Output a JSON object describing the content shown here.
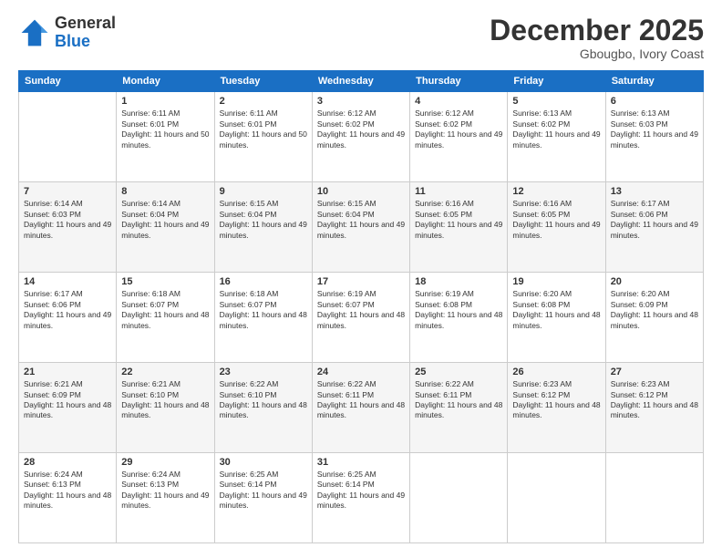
{
  "logo": {
    "general": "General",
    "blue": "Blue"
  },
  "header": {
    "month": "December 2025",
    "location": "Gbougbo, Ivory Coast"
  },
  "days_of_week": [
    "Sunday",
    "Monday",
    "Tuesday",
    "Wednesday",
    "Thursday",
    "Friday",
    "Saturday"
  ],
  "weeks": [
    [
      {
        "day": "",
        "sunrise": "",
        "sunset": "",
        "daylight": ""
      },
      {
        "day": "1",
        "sunrise": "Sunrise: 6:11 AM",
        "sunset": "Sunset: 6:01 PM",
        "daylight": "Daylight: 11 hours and 50 minutes."
      },
      {
        "day": "2",
        "sunrise": "Sunrise: 6:11 AM",
        "sunset": "Sunset: 6:01 PM",
        "daylight": "Daylight: 11 hours and 50 minutes."
      },
      {
        "day": "3",
        "sunrise": "Sunrise: 6:12 AM",
        "sunset": "Sunset: 6:02 PM",
        "daylight": "Daylight: 11 hours and 49 minutes."
      },
      {
        "day": "4",
        "sunrise": "Sunrise: 6:12 AM",
        "sunset": "Sunset: 6:02 PM",
        "daylight": "Daylight: 11 hours and 49 minutes."
      },
      {
        "day": "5",
        "sunrise": "Sunrise: 6:13 AM",
        "sunset": "Sunset: 6:02 PM",
        "daylight": "Daylight: 11 hours and 49 minutes."
      },
      {
        "day": "6",
        "sunrise": "Sunrise: 6:13 AM",
        "sunset": "Sunset: 6:03 PM",
        "daylight": "Daylight: 11 hours and 49 minutes."
      }
    ],
    [
      {
        "day": "7",
        "sunrise": "Sunrise: 6:14 AM",
        "sunset": "Sunset: 6:03 PM",
        "daylight": "Daylight: 11 hours and 49 minutes."
      },
      {
        "day": "8",
        "sunrise": "Sunrise: 6:14 AM",
        "sunset": "Sunset: 6:04 PM",
        "daylight": "Daylight: 11 hours and 49 minutes."
      },
      {
        "day": "9",
        "sunrise": "Sunrise: 6:15 AM",
        "sunset": "Sunset: 6:04 PM",
        "daylight": "Daylight: 11 hours and 49 minutes."
      },
      {
        "day": "10",
        "sunrise": "Sunrise: 6:15 AM",
        "sunset": "Sunset: 6:04 PM",
        "daylight": "Daylight: 11 hours and 49 minutes."
      },
      {
        "day": "11",
        "sunrise": "Sunrise: 6:16 AM",
        "sunset": "Sunset: 6:05 PM",
        "daylight": "Daylight: 11 hours and 49 minutes."
      },
      {
        "day": "12",
        "sunrise": "Sunrise: 6:16 AM",
        "sunset": "Sunset: 6:05 PM",
        "daylight": "Daylight: 11 hours and 49 minutes."
      },
      {
        "day": "13",
        "sunrise": "Sunrise: 6:17 AM",
        "sunset": "Sunset: 6:06 PM",
        "daylight": "Daylight: 11 hours and 49 minutes."
      }
    ],
    [
      {
        "day": "14",
        "sunrise": "Sunrise: 6:17 AM",
        "sunset": "Sunset: 6:06 PM",
        "daylight": "Daylight: 11 hours and 49 minutes."
      },
      {
        "day": "15",
        "sunrise": "Sunrise: 6:18 AM",
        "sunset": "Sunset: 6:07 PM",
        "daylight": "Daylight: 11 hours and 48 minutes."
      },
      {
        "day": "16",
        "sunrise": "Sunrise: 6:18 AM",
        "sunset": "Sunset: 6:07 PM",
        "daylight": "Daylight: 11 hours and 48 minutes."
      },
      {
        "day": "17",
        "sunrise": "Sunrise: 6:19 AM",
        "sunset": "Sunset: 6:07 PM",
        "daylight": "Daylight: 11 hours and 48 minutes."
      },
      {
        "day": "18",
        "sunrise": "Sunrise: 6:19 AM",
        "sunset": "Sunset: 6:08 PM",
        "daylight": "Daylight: 11 hours and 48 minutes."
      },
      {
        "day": "19",
        "sunrise": "Sunrise: 6:20 AM",
        "sunset": "Sunset: 6:08 PM",
        "daylight": "Daylight: 11 hours and 48 minutes."
      },
      {
        "day": "20",
        "sunrise": "Sunrise: 6:20 AM",
        "sunset": "Sunset: 6:09 PM",
        "daylight": "Daylight: 11 hours and 48 minutes."
      }
    ],
    [
      {
        "day": "21",
        "sunrise": "Sunrise: 6:21 AM",
        "sunset": "Sunset: 6:09 PM",
        "daylight": "Daylight: 11 hours and 48 minutes."
      },
      {
        "day": "22",
        "sunrise": "Sunrise: 6:21 AM",
        "sunset": "Sunset: 6:10 PM",
        "daylight": "Daylight: 11 hours and 48 minutes."
      },
      {
        "day": "23",
        "sunrise": "Sunrise: 6:22 AM",
        "sunset": "Sunset: 6:10 PM",
        "daylight": "Daylight: 11 hours and 48 minutes."
      },
      {
        "day": "24",
        "sunrise": "Sunrise: 6:22 AM",
        "sunset": "Sunset: 6:11 PM",
        "daylight": "Daylight: 11 hours and 48 minutes."
      },
      {
        "day": "25",
        "sunrise": "Sunrise: 6:22 AM",
        "sunset": "Sunset: 6:11 PM",
        "daylight": "Daylight: 11 hours and 48 minutes."
      },
      {
        "day": "26",
        "sunrise": "Sunrise: 6:23 AM",
        "sunset": "Sunset: 6:12 PM",
        "daylight": "Daylight: 11 hours and 48 minutes."
      },
      {
        "day": "27",
        "sunrise": "Sunrise: 6:23 AM",
        "sunset": "Sunset: 6:12 PM",
        "daylight": "Daylight: 11 hours and 48 minutes."
      }
    ],
    [
      {
        "day": "28",
        "sunrise": "Sunrise: 6:24 AM",
        "sunset": "Sunset: 6:13 PM",
        "daylight": "Daylight: 11 hours and 48 minutes."
      },
      {
        "day": "29",
        "sunrise": "Sunrise: 6:24 AM",
        "sunset": "Sunset: 6:13 PM",
        "daylight": "Daylight: 11 hours and 49 minutes."
      },
      {
        "day": "30",
        "sunrise": "Sunrise: 6:25 AM",
        "sunset": "Sunset: 6:14 PM",
        "daylight": "Daylight: 11 hours and 49 minutes."
      },
      {
        "day": "31",
        "sunrise": "Sunrise: 6:25 AM",
        "sunset": "Sunset: 6:14 PM",
        "daylight": "Daylight: 11 hours and 49 minutes."
      },
      {
        "day": "",
        "sunrise": "",
        "sunset": "",
        "daylight": ""
      },
      {
        "day": "",
        "sunrise": "",
        "sunset": "",
        "daylight": ""
      },
      {
        "day": "",
        "sunrise": "",
        "sunset": "",
        "daylight": ""
      }
    ]
  ]
}
